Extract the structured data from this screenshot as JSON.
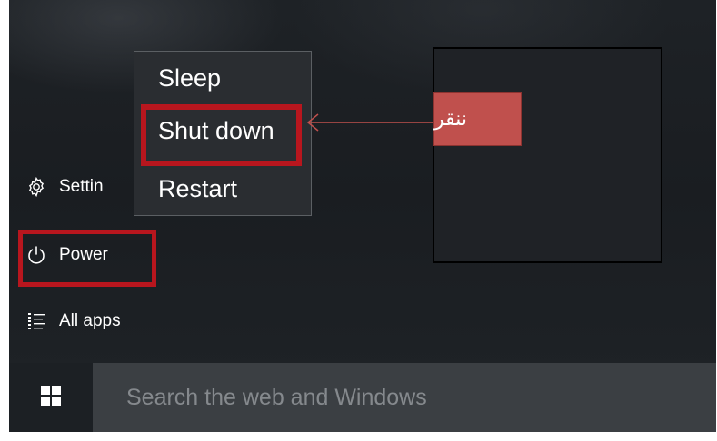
{
  "left_menu": {
    "settings_label": "Settin",
    "power_label": "Power",
    "all_apps_label": "All apps"
  },
  "power_menu": {
    "items": [
      {
        "label": "Sleep"
      },
      {
        "label": "Shut down"
      },
      {
        "label": "Restart"
      }
    ]
  },
  "annotation": {
    "label": "ننقر",
    "highlight_color": "#b8161e",
    "label_color": "#c0504d"
  },
  "taskbar": {
    "search_placeholder": "Search the web and Windows"
  },
  "icons": {
    "settings": "gear-icon",
    "power": "power-icon",
    "all_apps": "list-icon",
    "start": "windows-logo-icon"
  }
}
